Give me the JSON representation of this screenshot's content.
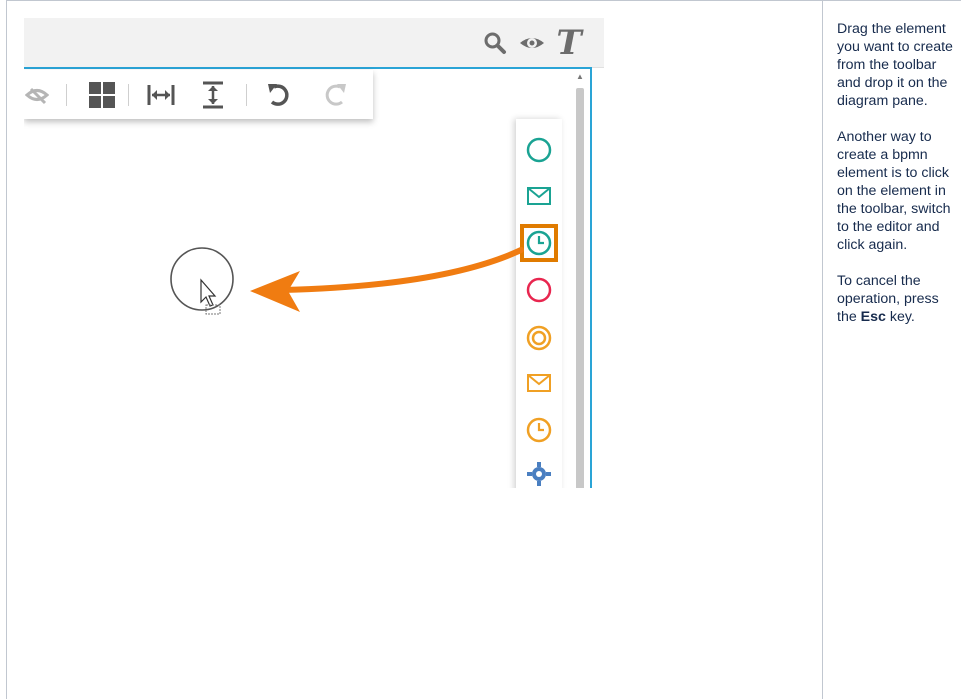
{
  "instructions": {
    "para1": "Drag the element you want to create from the toolbar and drop it on the diagram pane.",
    "para2": "Another way to create a bpmn element is to click on the element in the toolbar, switch to the editor and click again.",
    "para3_before": "To cancel the operation, press the ",
    "para3_key": "Esc",
    "para3_after": " key."
  },
  "topbar": {
    "icons": [
      "search-icon",
      "eye-icon",
      "text-icon"
    ],
    "text_icon_glyph": "T"
  },
  "toolbar": {
    "icons": [
      "view-icon",
      "layout-grid-icon",
      "distribute-horizontal-icon",
      "distribute-vertical-icon",
      "undo-icon",
      "redo-icon"
    ]
  },
  "palette": {
    "items": [
      {
        "name": "start-event-icon",
        "color": "#1aa393"
      },
      {
        "name": "message-start-event-icon",
        "color": "#1aa393"
      },
      {
        "name": "timer-start-event-icon",
        "color": "#1aa393"
      },
      {
        "name": "end-event-icon",
        "color": "#e8264f"
      },
      {
        "name": "intermediate-event-icon",
        "color": "#f0a024"
      },
      {
        "name": "intermediate-message-event-icon",
        "color": "#f0a024"
      },
      {
        "name": "intermediate-timer-event-icon",
        "color": "#f0a024"
      },
      {
        "name": "task-gear-icon",
        "color": "#4a7fc1"
      }
    ],
    "highlight_color": "#e07b00"
  },
  "colors": {
    "accent_border": "#2aa4d6",
    "arrow": "#f07c11"
  }
}
